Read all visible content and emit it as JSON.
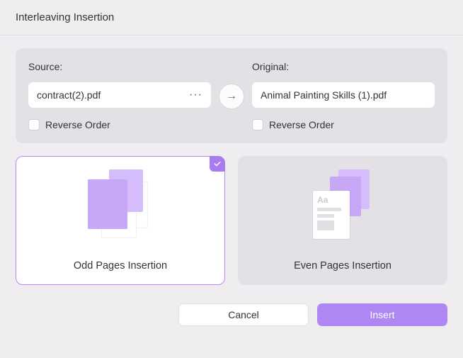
{
  "header": {
    "title": "Interleaving Insertion"
  },
  "source": {
    "label": "Source:",
    "file": "contract(2).pdf",
    "more": "···",
    "reverse_label": "Reverse Order"
  },
  "original": {
    "label": "Original:",
    "file": "Animal Painting Skills (1).pdf",
    "reverse_label": "Reverse Order"
  },
  "arrow": "→",
  "options": {
    "odd": {
      "label": "Odd Pages Insertion"
    },
    "even": {
      "label": "Even Pages Insertion"
    }
  },
  "footer": {
    "cancel": "Cancel",
    "insert": "Insert"
  },
  "colors": {
    "accent": "#a67cf0",
    "accent_light": "#c7a8f7"
  }
}
